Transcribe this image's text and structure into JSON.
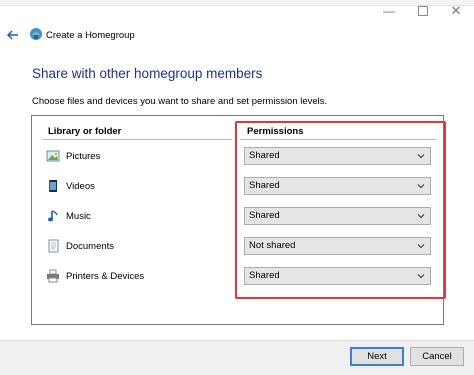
{
  "window": {
    "minimize_glyph": "—",
    "close_glyph": "✕"
  },
  "wizard": {
    "title": "Create a Homegroup",
    "heading": "Share with other homegroup members",
    "description": "Choose files and devices you want to share and set permission levels."
  },
  "table": {
    "col_library": "Library or folder",
    "col_permissions": "Permissions",
    "rows": [
      {
        "label": "Pictures",
        "icon": "pictures-icon",
        "permission": "Shared"
      },
      {
        "label": "Videos",
        "icon": "videos-icon",
        "permission": "Shared"
      },
      {
        "label": "Music",
        "icon": "music-icon",
        "permission": "Shared"
      },
      {
        "label": "Documents",
        "icon": "documents-icon",
        "permission": "Not shared"
      },
      {
        "label": "Printers & Devices",
        "icon": "printers-icon",
        "permission": "Shared"
      }
    ]
  },
  "annotation": {
    "highlight_color": "#e5333f"
  },
  "colors": {
    "heading": "#1e3287",
    "default_button_border": "#3c7fd6"
  },
  "buttons": {
    "next_label": "Next",
    "cancel_label": "Cancel"
  }
}
